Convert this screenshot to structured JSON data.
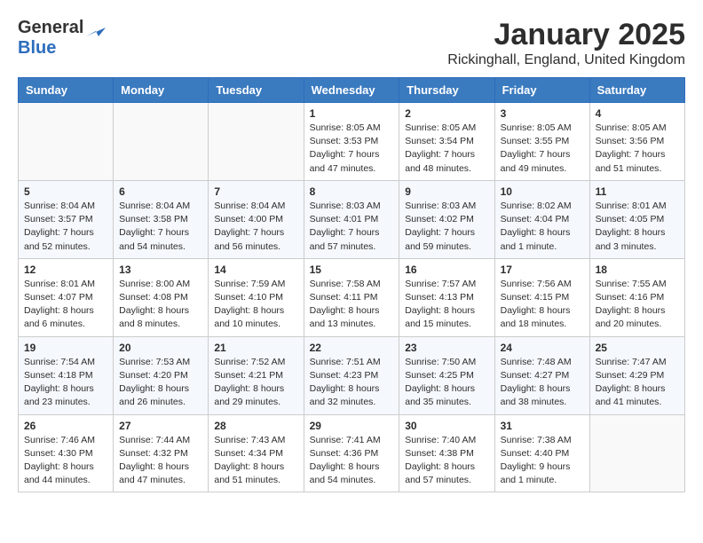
{
  "header": {
    "logo_line1": "General",
    "logo_line2": "Blue",
    "month": "January 2025",
    "location": "Rickinghall, England, United Kingdom"
  },
  "weekdays": [
    "Sunday",
    "Monday",
    "Tuesday",
    "Wednesday",
    "Thursday",
    "Friday",
    "Saturday"
  ],
  "weeks": [
    [
      {
        "day": "",
        "info": ""
      },
      {
        "day": "",
        "info": ""
      },
      {
        "day": "",
        "info": ""
      },
      {
        "day": "1",
        "info": "Sunrise: 8:05 AM\nSunset: 3:53 PM\nDaylight: 7 hours and 47 minutes."
      },
      {
        "day": "2",
        "info": "Sunrise: 8:05 AM\nSunset: 3:54 PM\nDaylight: 7 hours and 48 minutes."
      },
      {
        "day": "3",
        "info": "Sunrise: 8:05 AM\nSunset: 3:55 PM\nDaylight: 7 hours and 49 minutes."
      },
      {
        "day": "4",
        "info": "Sunrise: 8:05 AM\nSunset: 3:56 PM\nDaylight: 7 hours and 51 minutes."
      }
    ],
    [
      {
        "day": "5",
        "info": "Sunrise: 8:04 AM\nSunset: 3:57 PM\nDaylight: 7 hours and 52 minutes."
      },
      {
        "day": "6",
        "info": "Sunrise: 8:04 AM\nSunset: 3:58 PM\nDaylight: 7 hours and 54 minutes."
      },
      {
        "day": "7",
        "info": "Sunrise: 8:04 AM\nSunset: 4:00 PM\nDaylight: 7 hours and 56 minutes."
      },
      {
        "day": "8",
        "info": "Sunrise: 8:03 AM\nSunset: 4:01 PM\nDaylight: 7 hours and 57 minutes."
      },
      {
        "day": "9",
        "info": "Sunrise: 8:03 AM\nSunset: 4:02 PM\nDaylight: 7 hours and 59 minutes."
      },
      {
        "day": "10",
        "info": "Sunrise: 8:02 AM\nSunset: 4:04 PM\nDaylight: 8 hours and 1 minute."
      },
      {
        "day": "11",
        "info": "Sunrise: 8:01 AM\nSunset: 4:05 PM\nDaylight: 8 hours and 3 minutes."
      }
    ],
    [
      {
        "day": "12",
        "info": "Sunrise: 8:01 AM\nSunset: 4:07 PM\nDaylight: 8 hours and 6 minutes."
      },
      {
        "day": "13",
        "info": "Sunrise: 8:00 AM\nSunset: 4:08 PM\nDaylight: 8 hours and 8 minutes."
      },
      {
        "day": "14",
        "info": "Sunrise: 7:59 AM\nSunset: 4:10 PM\nDaylight: 8 hours and 10 minutes."
      },
      {
        "day": "15",
        "info": "Sunrise: 7:58 AM\nSunset: 4:11 PM\nDaylight: 8 hours and 13 minutes."
      },
      {
        "day": "16",
        "info": "Sunrise: 7:57 AM\nSunset: 4:13 PM\nDaylight: 8 hours and 15 minutes."
      },
      {
        "day": "17",
        "info": "Sunrise: 7:56 AM\nSunset: 4:15 PM\nDaylight: 8 hours and 18 minutes."
      },
      {
        "day": "18",
        "info": "Sunrise: 7:55 AM\nSunset: 4:16 PM\nDaylight: 8 hours and 20 minutes."
      }
    ],
    [
      {
        "day": "19",
        "info": "Sunrise: 7:54 AM\nSunset: 4:18 PM\nDaylight: 8 hours and 23 minutes."
      },
      {
        "day": "20",
        "info": "Sunrise: 7:53 AM\nSunset: 4:20 PM\nDaylight: 8 hours and 26 minutes."
      },
      {
        "day": "21",
        "info": "Sunrise: 7:52 AM\nSunset: 4:21 PM\nDaylight: 8 hours and 29 minutes."
      },
      {
        "day": "22",
        "info": "Sunrise: 7:51 AM\nSunset: 4:23 PM\nDaylight: 8 hours and 32 minutes."
      },
      {
        "day": "23",
        "info": "Sunrise: 7:50 AM\nSunset: 4:25 PM\nDaylight: 8 hours and 35 minutes."
      },
      {
        "day": "24",
        "info": "Sunrise: 7:48 AM\nSunset: 4:27 PM\nDaylight: 8 hours and 38 minutes."
      },
      {
        "day": "25",
        "info": "Sunrise: 7:47 AM\nSunset: 4:29 PM\nDaylight: 8 hours and 41 minutes."
      }
    ],
    [
      {
        "day": "26",
        "info": "Sunrise: 7:46 AM\nSunset: 4:30 PM\nDaylight: 8 hours and 44 minutes."
      },
      {
        "day": "27",
        "info": "Sunrise: 7:44 AM\nSunset: 4:32 PM\nDaylight: 8 hours and 47 minutes."
      },
      {
        "day": "28",
        "info": "Sunrise: 7:43 AM\nSunset: 4:34 PM\nDaylight: 8 hours and 51 minutes."
      },
      {
        "day": "29",
        "info": "Sunrise: 7:41 AM\nSunset: 4:36 PM\nDaylight: 8 hours and 54 minutes."
      },
      {
        "day": "30",
        "info": "Sunrise: 7:40 AM\nSunset: 4:38 PM\nDaylight: 8 hours and 57 minutes."
      },
      {
        "day": "31",
        "info": "Sunrise: 7:38 AM\nSunset: 4:40 PM\nDaylight: 9 hours and 1 minute."
      },
      {
        "day": "",
        "info": ""
      }
    ]
  ]
}
